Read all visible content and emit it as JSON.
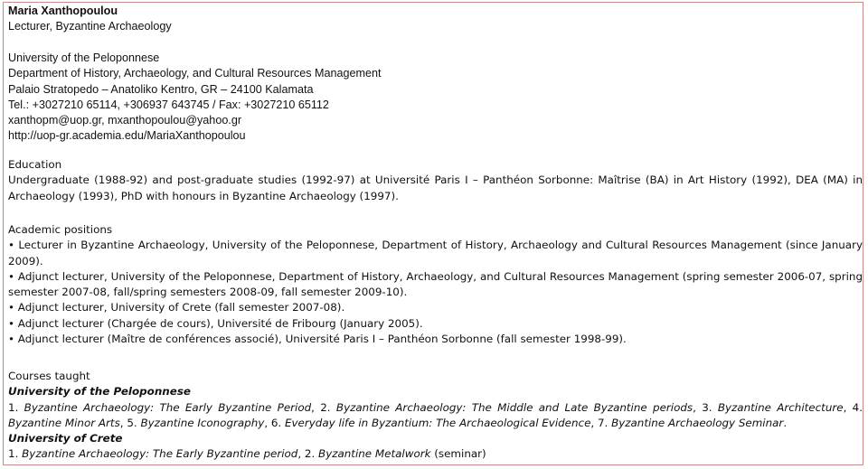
{
  "header": {
    "name": "Maria Xanthopoulou",
    "title": "Lecturer, Byzantine Archaeology"
  },
  "contact": [
    "University of the Peloponnese",
    "Department of History, Archaeology, and Cultural Resources Management",
    "Palaio Stratopedo – Anatoliko Kentro, GR – 24100 Kalamata",
    "Tel.: +3027210 65114, +306937 643745 / Fax: +3027210 65112",
    "xanthopm@uop.gr, mxanthopoulou@yahoo.gr",
    "http://uop-gr.academia.edu/MariaXanthopoulou"
  ],
  "education": {
    "heading": "Education",
    "text": "Undergraduate (1988-92) and post-graduate studies (1992-97) at Université Paris I – Panthéon Sorbonne: Maîtrise (BA) in Art History (1992), DEA (MA) in Archaeology (1993), PhD with honours in Byzantine Archaeology (1997)."
  },
  "positions": {
    "heading": "Academic positions",
    "items": [
      "• Lecturer in Byzantine Archaeology, University of the Peloponnese, Department of History, Archaeology and Cultural Resources Management (since January 2009).",
      "• Adjunct lecturer, University of the Peloponnese, Department of History, Archaeology, and Cultural Resources Management (spring semester 2006-07, spring semester 2007-08, fall/spring semesters 2008-09, fall semester 2009-10).",
      "• Adjunct lecturer, University of Crete (fall semester 2007-08).",
      "• Adjunct lecturer (Chargée de cours), Université de Fribourg (January 2005).",
      "• Adjunct lecturer (Maître de conférences associé), Université Paris I – Panthéon Sorbonne (fall semester 1998-99)."
    ]
  },
  "courses": {
    "heading": "Courses taught",
    "peloponnese": {
      "institution": "University of the Peloponnese",
      "c1_num": "1. ",
      "c1": "Byzantine Archaeology: The Early Byzantine Period",
      "c2_num": ", 2. ",
      "c2": "Byzantine Archaeology: The Middle and Late Byzantine periods",
      "c3_num": ", 3. ",
      "c3": "Byzantine Architecture",
      "c4_num": ", 4.",
      "c4": "Byzantine Minor Arts",
      "c5_num": ", 5. ",
      "c5": "Byzantine Iconography",
      "c6_num": ", 6. ",
      "c6": "Everyday life in Byzantium: The Archaeological Evidence",
      "c7_num": ", 7. ",
      "c7": "Byzantine Archaeology Seminar",
      "end": "."
    },
    "crete": {
      "institution": "University of Crete",
      "c1_num": "1. ",
      "c1": "Byzantine Archaeology: The Early Byzantine period",
      "c2_num": ", 2. ",
      "c2": "Byzantine Metalwork",
      "c2_note": " (seminar)"
    }
  }
}
